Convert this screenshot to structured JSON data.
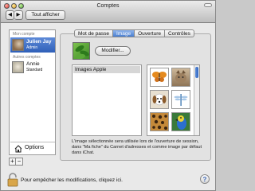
{
  "window": {
    "title": "Comptes",
    "nav_prev": "◀",
    "nav_next": "▶",
    "show_all": "Tout afficher"
  },
  "sidebar": {
    "my_account_label": "Mon compte",
    "other_accounts_label": "Autres comptes",
    "accounts": [
      {
        "name": "Julien Jay",
        "role": "Admin",
        "selected": true
      },
      {
        "name": "Annie",
        "role": "Standard",
        "selected": false
      }
    ],
    "options_label": "Options",
    "add_label": "+",
    "remove_label": "−"
  },
  "tabs": [
    {
      "label": "Mot de passe",
      "active": false
    },
    {
      "label": "Image",
      "active": true
    },
    {
      "label": "Ouverture",
      "active": false
    },
    {
      "label": "Contrôles",
      "active": false
    }
  ],
  "image_tab": {
    "modify_button": "Modifier...",
    "list_items": [
      "Images Apple"
    ],
    "grid_images": [
      "butterfly",
      "cat",
      "dog",
      "dragonfly",
      "leopard-fur",
      "parrot"
    ],
    "description": "L'image sélectionnée sera utilisée lors de l'ouverture de session, dans \"Ma fiche\" du Carnet d'adresses et comme image par défaut dans iChat."
  },
  "footer": {
    "lock_text": "Pour empêcher les modifications, cliquez ici.",
    "help_label": "?"
  },
  "colors": {
    "selection": "#3c6cc4",
    "tab_active": "#5a8ad8"
  }
}
